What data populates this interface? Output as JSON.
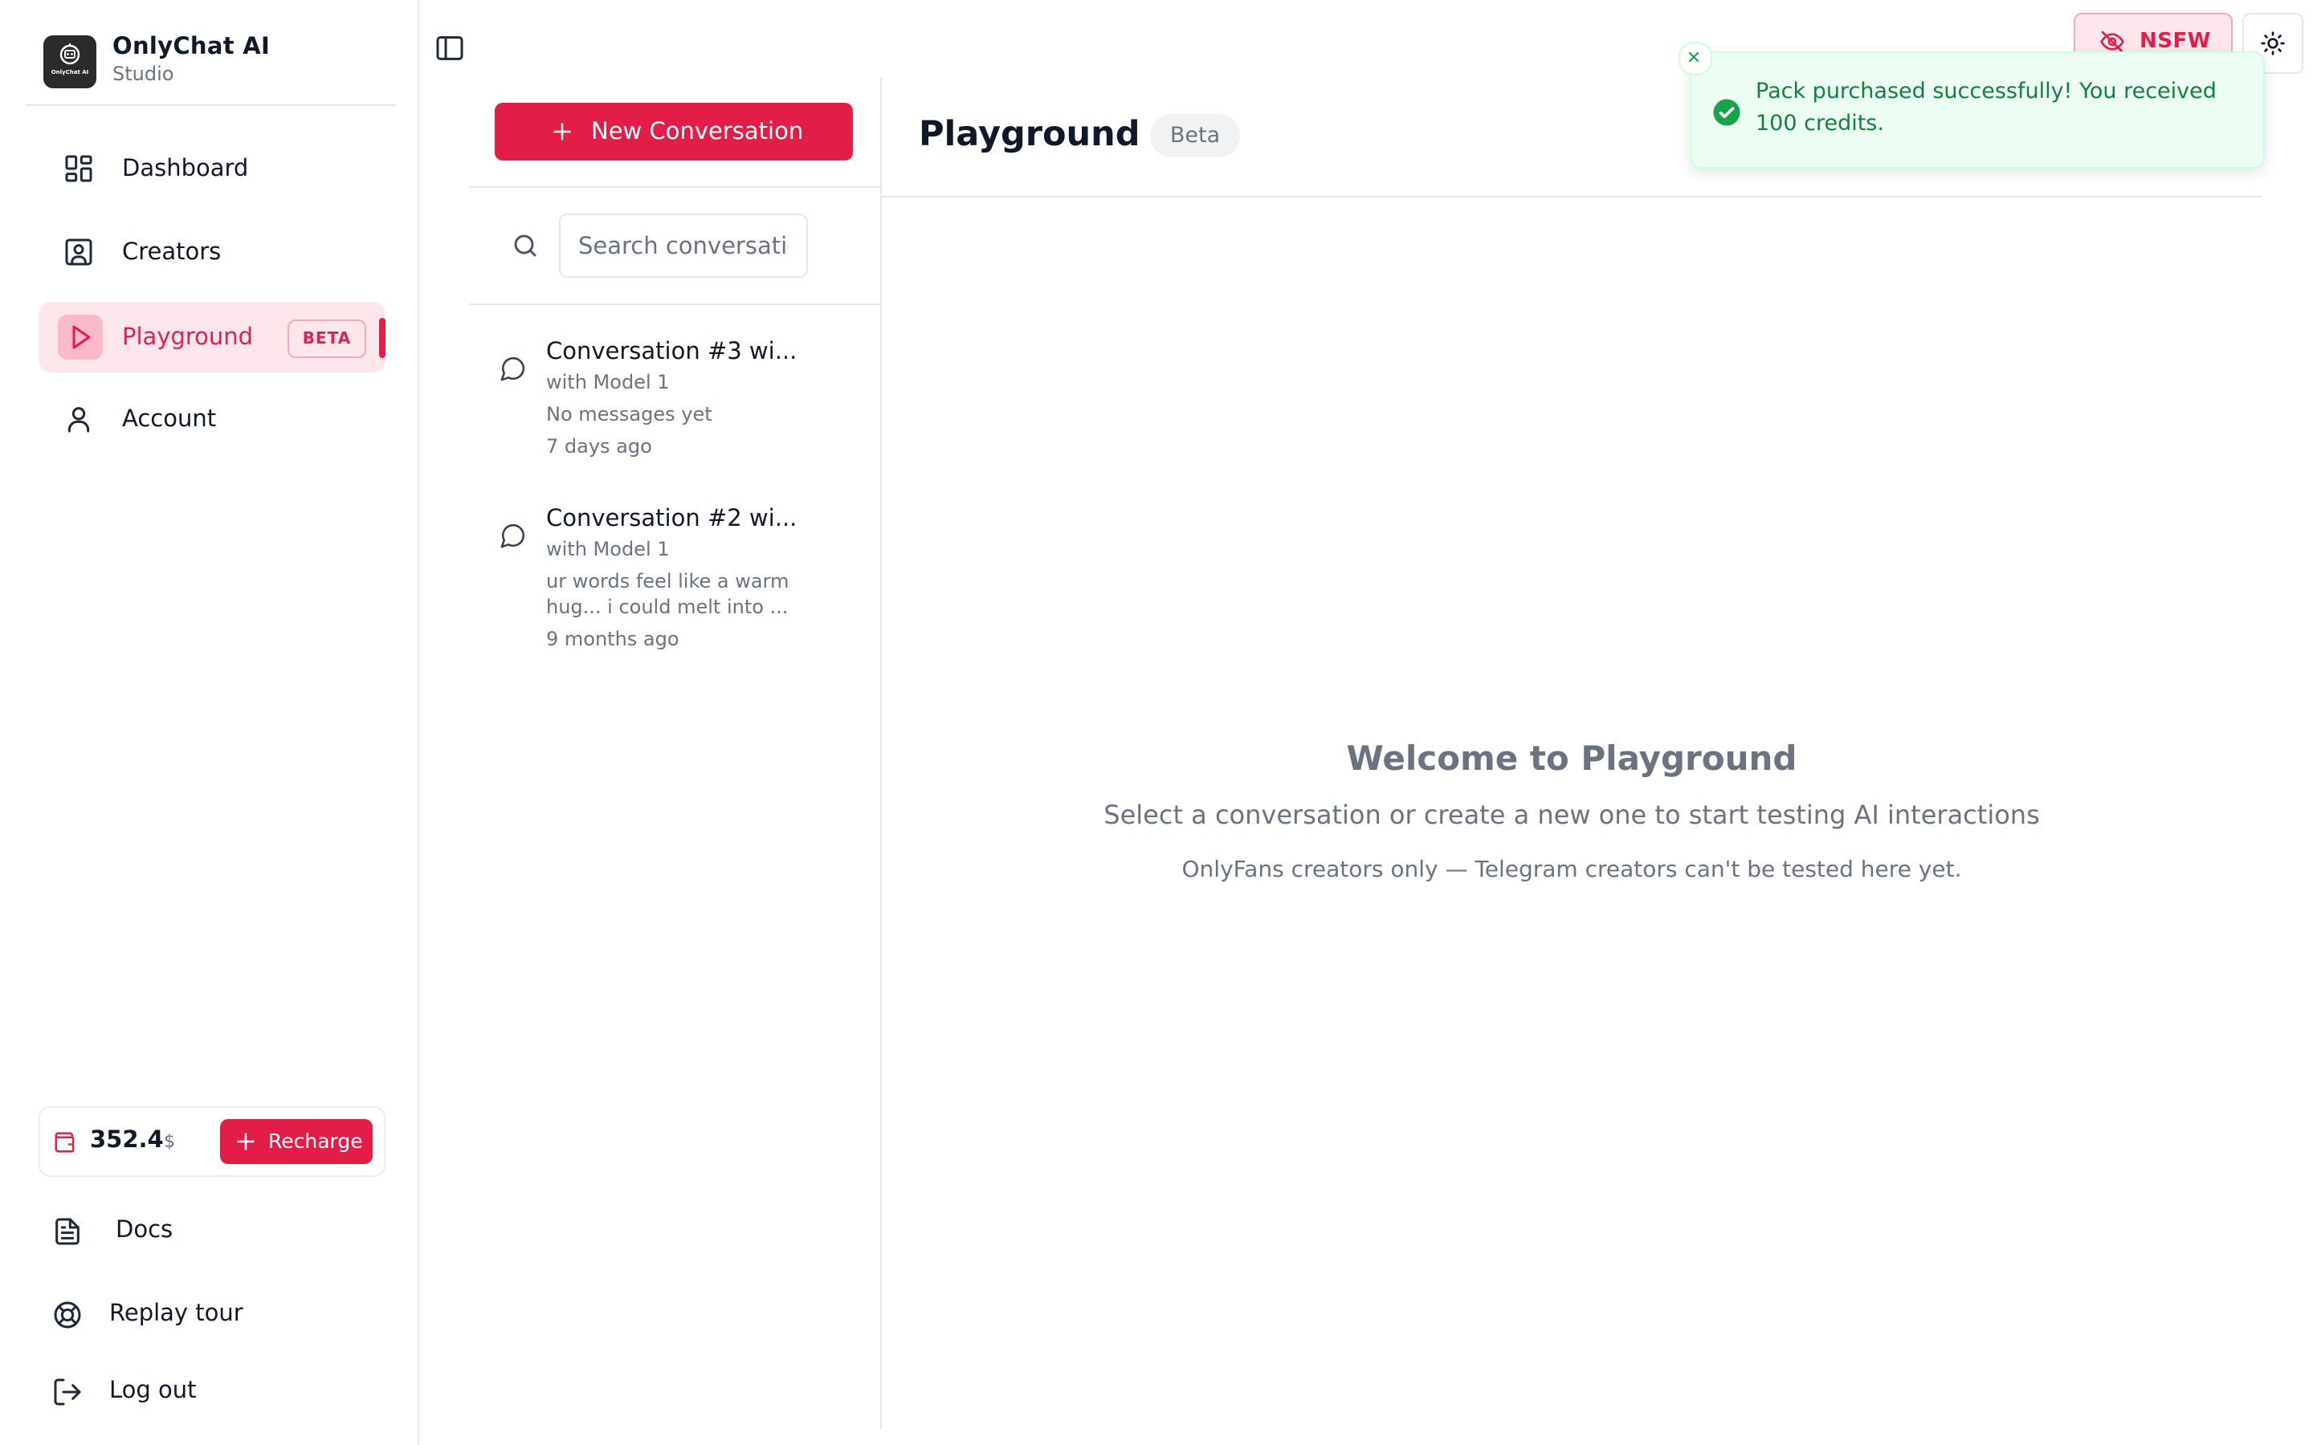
{
  "app": {
    "name": "OnlyChat AI",
    "subtitle": "Studio",
    "logo_text": "OnlyChat AI"
  },
  "sidebar": {
    "items": [
      {
        "label": "Dashboard",
        "icon": "dashboard-icon"
      },
      {
        "label": "Creators",
        "icon": "user-square-icon"
      },
      {
        "label": "Playground",
        "icon": "play-icon",
        "badge": "BETA",
        "active": true
      },
      {
        "label": "Account",
        "icon": "user-icon"
      }
    ],
    "wallet": {
      "balance": "352.4",
      "currency": "$",
      "recharge_label": "Recharge"
    },
    "bottom_items": [
      {
        "label": "Docs",
        "icon": "file-text-icon"
      },
      {
        "label": "Replay tour",
        "icon": "lifebuoy-icon"
      },
      {
        "label": "Log out",
        "icon": "log-out-icon"
      }
    ]
  },
  "conversations": {
    "new_button_label": "New Conversation",
    "search_placeholder": "Search conversations...",
    "items": [
      {
        "title": "Conversation #3 wi...",
        "model": "with Model 1",
        "preview": [
          "No messages yet"
        ],
        "time": "7 days ago"
      },
      {
        "title": "Conversation #2 wi...",
        "model": "with Model 1",
        "preview": [
          "ur words feel like a warm",
          "hug... i could melt into ..."
        ],
        "time": "9 months ago"
      }
    ]
  },
  "main": {
    "title": "Playground",
    "badge": "Beta",
    "welcome_title": "Welcome to Playground",
    "welcome_subtitle": "Select a conversation or create a new one to start testing AI interactions",
    "welcome_note": "OnlyFans creators only — Telegram creators can't be tested here yet."
  },
  "header": {
    "nsfw_label": "NSFW"
  },
  "toast": {
    "message": "Pack purchased successfully! You received 100 credits."
  },
  "colors": {
    "accent": "#e11d48",
    "accent_light": "#fde7ec",
    "success": "#15803d",
    "success_bg": "#ecfdf3"
  }
}
